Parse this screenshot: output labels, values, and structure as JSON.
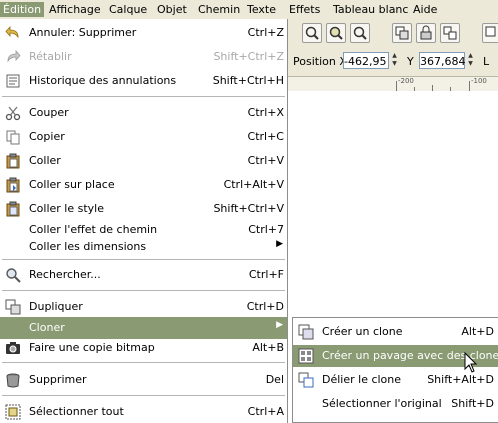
{
  "menubar": {
    "items": [
      {
        "label": "Édition",
        "active": true
      },
      {
        "label": "Affichage"
      },
      {
        "label": "Calque"
      },
      {
        "label": "Objet"
      },
      {
        "label": "Chemin"
      },
      {
        "label": "Texte"
      },
      {
        "label": "Effets"
      },
      {
        "label": "Tableau blanc"
      },
      {
        "label": "Aide"
      }
    ]
  },
  "toolbar": {
    "position_x_label": "Position X",
    "position_x_value": "-462,95",
    "y_label": "Y",
    "y_value": "367,684",
    "l_label": "L",
    "ruler_labels": [
      "-200",
      "-100"
    ]
  },
  "edit_menu": {
    "items": [
      {
        "label": "Annuler: Supprimer",
        "accel": "Ctrl+Z",
        "icon": "undo-icon"
      },
      {
        "label": "Rétablir",
        "accel": "Shift+Ctrl+Z",
        "icon": "redo-icon",
        "disabled": true
      },
      {
        "label": "Historique des annulations",
        "accel": "Shift+Ctrl+H",
        "icon": "history-icon"
      },
      {
        "label": "Couper",
        "accel": "Ctrl+X",
        "icon": "scissors-icon"
      },
      {
        "label": "Copier",
        "accel": "Ctrl+C",
        "icon": "copy-icon"
      },
      {
        "label": "Coller",
        "accel": "Ctrl+V",
        "icon": "paste-icon"
      },
      {
        "label": "Coller sur place",
        "accel": "Ctrl+Alt+V",
        "icon": "paste-in-place-icon"
      },
      {
        "label": "Coller le style",
        "accel": "Shift+Ctrl+V",
        "icon": "paste-style-icon"
      },
      {
        "label": "Coller l'effet de chemin",
        "accel": "Ctrl+7"
      },
      {
        "label": "Coller les dimensions"
      },
      {
        "label": "Rechercher...",
        "accel": "Ctrl+F",
        "icon": "search-icon"
      },
      {
        "label": "Dupliquer",
        "accel": "Ctrl+D",
        "icon": "duplicate-icon"
      },
      {
        "label": "Cloner",
        "highlighted": true
      },
      {
        "label": "Faire une copie bitmap",
        "accel": "Alt+B",
        "icon": "camera-icon"
      },
      {
        "label": "Supprimer",
        "accel": "Del",
        "icon": "trash-icon"
      },
      {
        "label": "Sélectionner tout",
        "accel": "Ctrl+A",
        "icon": "select-all-icon"
      }
    ]
  },
  "clone_submenu": {
    "items": [
      {
        "label": "Créer un clone",
        "accel": "Alt+D",
        "icon": "clone-icon"
      },
      {
        "label": "Créer un pavage avec des clones...",
        "highlighted": true,
        "icon": "tile-clones-icon"
      },
      {
        "label": "Délier le clone",
        "accel": "Shift+Alt+D",
        "icon": "unlink-clone-icon"
      },
      {
        "label": "Sélectionner l'original",
        "accel": "Shift+D"
      }
    ]
  },
  "colors": {
    "highlight": "#8a9a72",
    "menubar_bg": "#ece9d8",
    "menu_bg": "#ffffff",
    "disabled_text": "#a8a8a8"
  }
}
